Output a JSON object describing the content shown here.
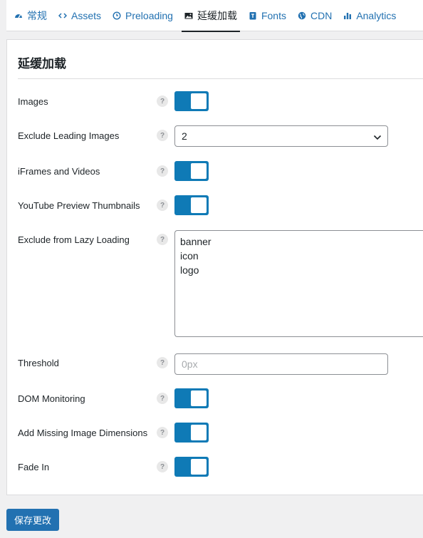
{
  "tabs": [
    {
      "label": "常规",
      "icon": "dashboard-icon"
    },
    {
      "label": "Assets",
      "icon": "code-icon"
    },
    {
      "label": "Preloading",
      "icon": "clock-icon"
    },
    {
      "label": "延缓加载",
      "icon": "image-icon",
      "active": true
    },
    {
      "label": "Fonts",
      "icon": "font-icon"
    },
    {
      "label": "CDN",
      "icon": "globe-icon"
    },
    {
      "label": "Analytics",
      "icon": "bar-chart-icon"
    }
  ],
  "panel": {
    "title": "延缓加载"
  },
  "settings": {
    "images": {
      "label": "Images",
      "enabled": true
    },
    "exclude_leading": {
      "label": "Exclude Leading Images",
      "value": "2"
    },
    "iframes": {
      "label": "iFrames and Videos",
      "enabled": true
    },
    "youtube": {
      "label": "YouTube Preview Thumbnails",
      "enabled": true
    },
    "exclude_lazy": {
      "label": "Exclude from Lazy Loading",
      "lines": [
        "banner",
        "icon",
        "logo"
      ]
    },
    "threshold": {
      "label": "Threshold",
      "placeholder": "0px"
    },
    "dom": {
      "label": "DOM Monitoring",
      "enabled": true
    },
    "missing_dims": {
      "label": "Add Missing Image Dimensions",
      "enabled": true
    },
    "fade_in": {
      "label": "Fade In",
      "enabled": true
    }
  },
  "help_glyph": "?",
  "save_label": "保存更改",
  "colors": {
    "accent": "#2271b1",
    "toggle_on": "#0f7ab6"
  }
}
